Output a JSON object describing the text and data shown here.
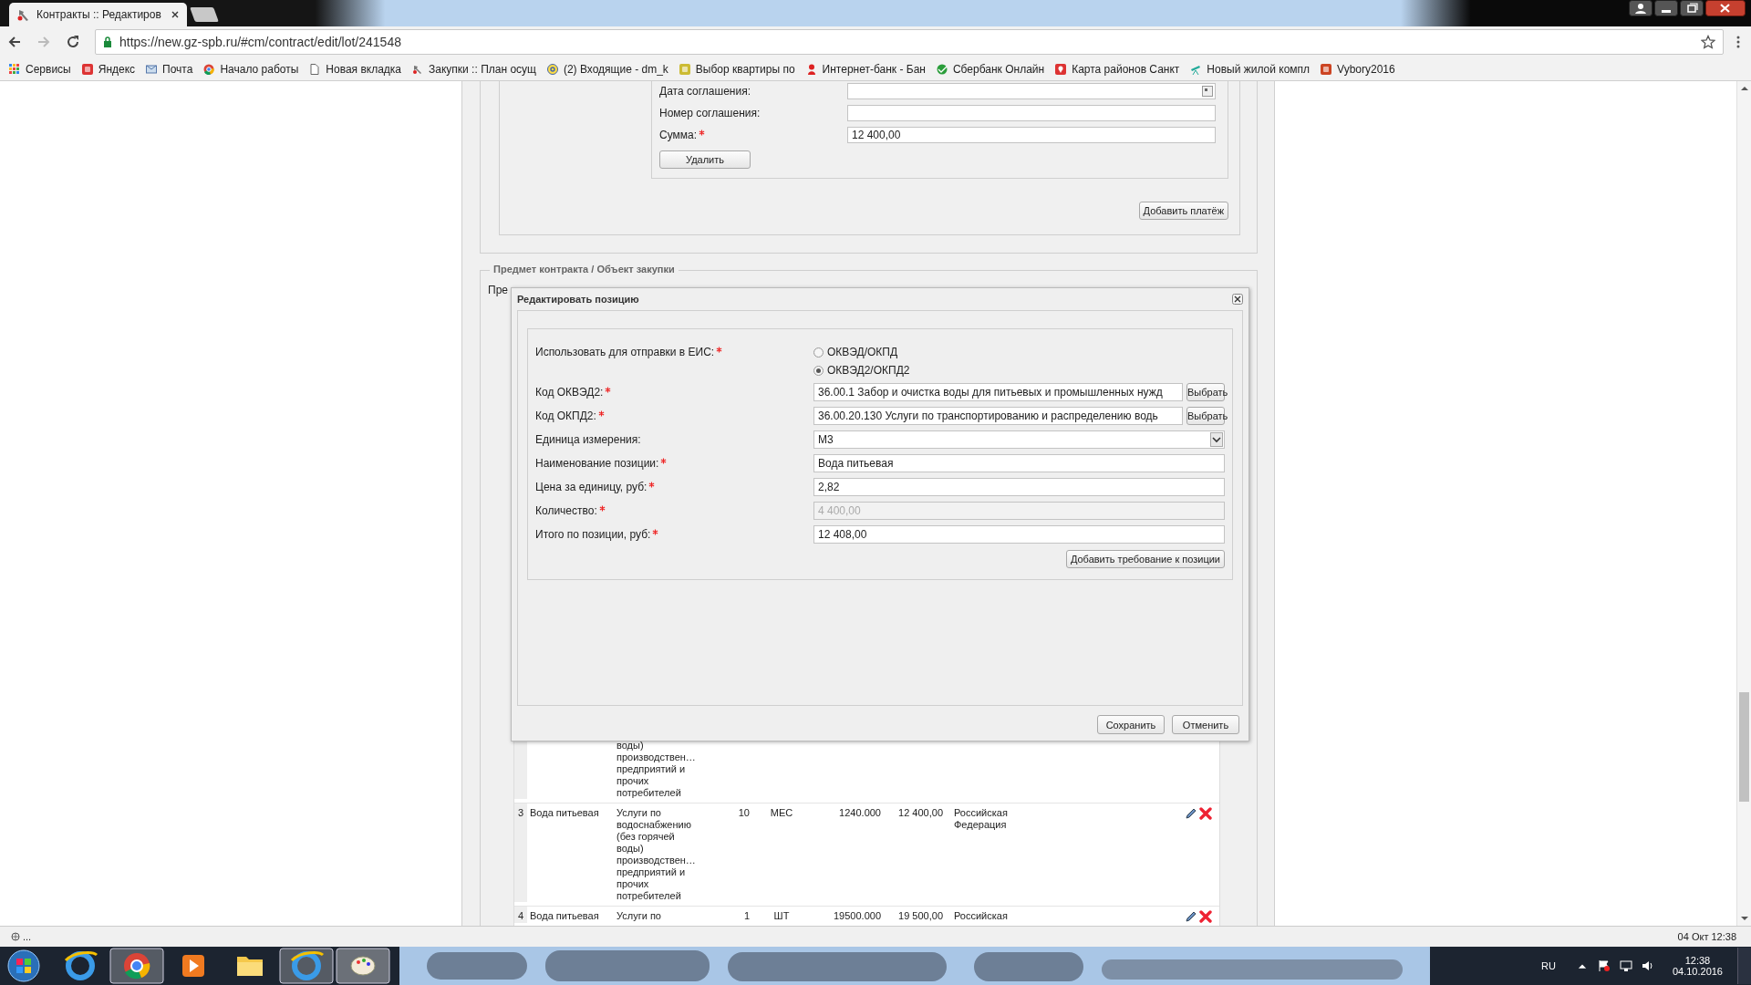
{
  "browser": {
    "tab_title": "Контракты :: Редактиров",
    "url": "https://new.gz-spb.ru/#cm/contract/edit/lot/241548",
    "bookmarks": [
      {
        "label": "Сервисы",
        "kind": "apps"
      },
      {
        "label": "Яндекс",
        "kind": "site"
      },
      {
        "label": "Почта",
        "kind": "mail"
      },
      {
        "label": "Начало работы",
        "kind": "chrome"
      },
      {
        "label": "Новая вкладка",
        "kind": "page"
      },
      {
        "label": "Закупки :: План осущ",
        "kind": "hammer"
      },
      {
        "label": "(2) Входящие - dm_k",
        "kind": "at"
      },
      {
        "label": "Выбор квартиры по",
        "kind": "site"
      },
      {
        "label": "Интернет-банк - Бан",
        "kind": "person"
      },
      {
        "label": "Сбербанк Онлайн",
        "kind": "leaf"
      },
      {
        "label": "Карта районов Санкт",
        "kind": "pin"
      },
      {
        "label": "Новый жилой компл",
        "kind": "scope"
      },
      {
        "label": "Vybory2016",
        "kind": "site"
      }
    ]
  },
  "payment": {
    "fields": [
      {
        "label": "Дата соглашения:",
        "kind": "date"
      },
      {
        "label": "Номер соглашения:",
        "kind": "text"
      },
      {
        "label": "Сумма:",
        "kind": "text",
        "required": true,
        "value": "12 400,00"
      }
    ],
    "delete_button": "Удалить",
    "add_button": "Добавить платёж"
  },
  "section": {
    "title": "Предмет контракта / Объект закупки",
    "cut_label": "Пре"
  },
  "dialog": {
    "title": "Редактировать позицию",
    "fields": [
      {
        "label": "Использовать для отправки в ЕИС:",
        "required": true,
        "kind": "radio",
        "options": [
          {
            "label": "ОКВЭД/ОКПД",
            "selected": false
          },
          {
            "label": "ОКВЭД2/ОКПД2",
            "selected": true
          }
        ]
      },
      {
        "label": "Код ОКВЭД2:",
        "required": true,
        "kind": "picker",
        "value": "36.00.1 Забор и очистка воды для питьевых и промышленных нужд",
        "button": "Выбрать"
      },
      {
        "label": "Код ОКПД2:",
        "required": true,
        "kind": "picker",
        "value": "36.00.20.130 Услуги по транспортированию и распределению водь",
        "button": "Выбрать"
      },
      {
        "label": "Единица измерения:",
        "kind": "select",
        "value": "М3"
      },
      {
        "label": "Наименование позиции:",
        "required": true,
        "kind": "text",
        "value": "Вода питьевая",
        "disabled": false
      },
      {
        "label": "Цена за единицу, руб:",
        "required": true,
        "kind": "text",
        "value": "2,82",
        "disabled": false
      },
      {
        "label": "Количество:",
        "required": true,
        "kind": "text",
        "value": "4 400,00",
        "disabled": true
      },
      {
        "label": "Итого по позиции, руб:",
        "required": true,
        "kind": "text",
        "value": "12 408,00",
        "disabled": false
      }
    ],
    "add_requirement_button": "Добавить требование к позиции",
    "buttons": [
      "Сохранить",
      "Отменить"
    ]
  },
  "table_rows": [
    {
      "description": [
        "воды)",
        "производствен…",
        "предприятий и",
        "прочих",
        "потребителей"
      ]
    },
    {
      "number": "3",
      "name": "Вода питьевая",
      "description": [
        "Услуги по",
        "водоснабжению",
        "(без горячей",
        "воды)",
        "производствен…",
        "предприятий и",
        "прочих",
        "потребителей"
      ],
      "quantity": "10",
      "unit": "МЕС",
      "price": "1240.000",
      "total": "12 400,00",
      "country": [
        "Российская",
        "Федерация"
      ]
    },
    {
      "number": "4",
      "name": "Вода питьевая",
      "description": [
        "Услуги по"
      ],
      "quantity": "1",
      "unit": "ШТ",
      "price": "19500.000",
      "total": "19 500,00",
      "country": [
        "Российская"
      ]
    }
  ],
  "status_bar": {
    "left": "...",
    "right": "04 Окт 12:38"
  },
  "taskbar": {
    "language": "RU",
    "time": "12:38",
    "date": "04.10.2016"
  }
}
